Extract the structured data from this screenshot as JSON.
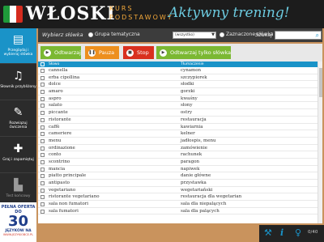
{
  "header": {
    "app_title": "WŁOSKI",
    "kurs_line1": "KURS",
    "kurs_line2": "PODSTAWOWY",
    "mode_title": "Aktywny trening!",
    "flag_colors": [
      "#1f9a3a",
      "#ffffff",
      "#d52b1e"
    ]
  },
  "sidebar": {
    "items": [
      {
        "label": "Przeglądaj i wybieraj słówka",
        "icon": "list-icon"
      },
      {
        "label": "Słownik przybliżony",
        "icon": "headphones-icon"
      },
      {
        "label": "Rozwiązuj ćwiczenia",
        "icon": "pencil-icon"
      },
      {
        "label": "Graj i zapamiętuj",
        "icon": "puzzle-icon"
      },
      {
        "label": "Test końcowy",
        "icon": "test-icon"
      }
    ],
    "promo": {
      "line1": "PEŁNA OFERTA DO",
      "number": "30",
      "line3": "JĘZYKÓW NA",
      "line4": "WWW.JEZYKIOBCE.PL"
    }
  },
  "filter": {
    "label": "Wybierz słówka",
    "option1": "Grupa tematyczna",
    "select_value": "(wszystko)",
    "option2": "Zaznaczone słówka",
    "search_label": "Szukaj"
  },
  "actions": {
    "play": "Odtwarzaj",
    "pause": "Pauza",
    "stop": "Stop",
    "play_selected": "Odtwarzaj tylko słówka"
  },
  "table": {
    "col1": "Słowo",
    "col2": "Tłumaczenie",
    "rows": [
      {
        "word": "cannella",
        "translation": "cynamon"
      },
      {
        "word": "erba cipollina",
        "translation": "szczypiorek"
      },
      {
        "word": "dolce",
        "translation": "słodki"
      },
      {
        "word": "amaro",
        "translation": "gorzki"
      },
      {
        "word": "aspro",
        "translation": "kwaśny"
      },
      {
        "word": "salato",
        "translation": "słony"
      },
      {
        "word": "piccante",
        "translation": "ostry"
      },
      {
        "word": "ristorante",
        "translation": "restauracja"
      },
      {
        "word": "caffè",
        "translation": "kawiarnia"
      },
      {
        "word": "cameriere",
        "translation": "kelner"
      },
      {
        "word": "menu",
        "translation": "jadłospis, menu"
      },
      {
        "word": "ordinazione",
        "translation": "zamówienie"
      },
      {
        "word": "conto",
        "translation": "rachunek"
      },
      {
        "word": "scontrino",
        "translation": "paragon"
      },
      {
        "word": "mancia",
        "translation": "napiwek"
      },
      {
        "word": "piatto principale",
        "translation": "danie główne"
      },
      {
        "word": "antipasto",
        "translation": "przystawka"
      },
      {
        "word": "vegetariano",
        "translation": "wegetariański"
      },
      {
        "word": "ristorante vegetariano",
        "translation": "restauracja dla wegetarian"
      },
      {
        "word": "sala non fumatori",
        "translation": "sala dla niepalących"
      },
      {
        "word": "sala fumatori",
        "translation": "sala dla palących"
      }
    ]
  },
  "footer": {
    "counter": "0/40"
  }
}
